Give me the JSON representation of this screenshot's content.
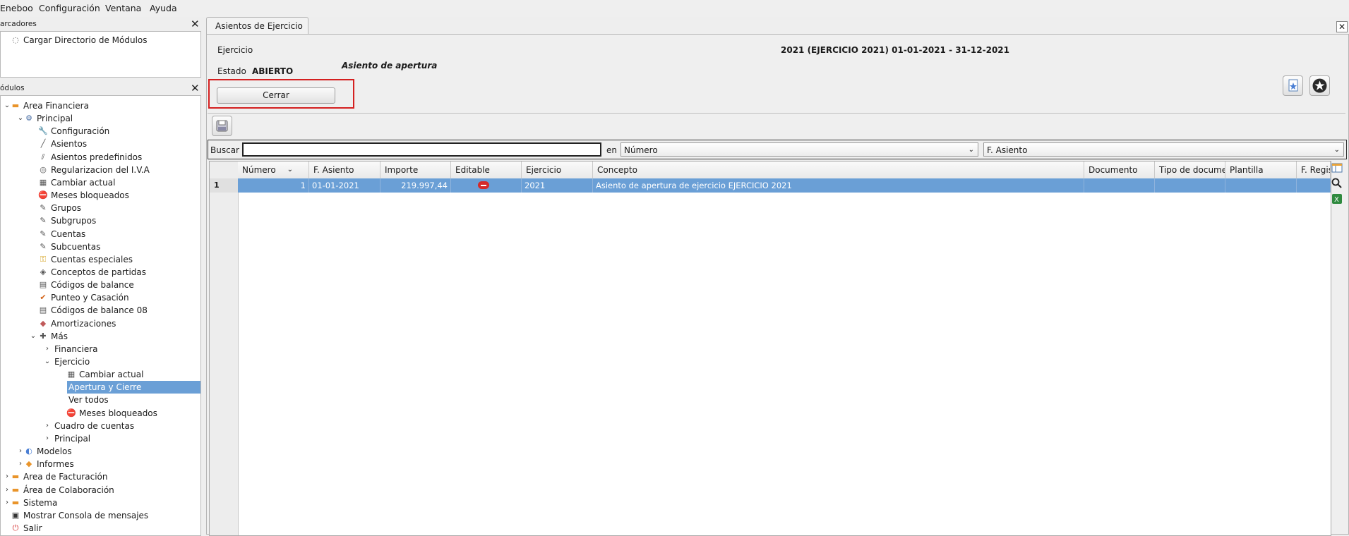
{
  "menubar": {
    "items": [
      "Eneboo",
      "Configuración",
      "Ventana",
      "Ayuda"
    ]
  },
  "bookmarks": {
    "title": "arcadores",
    "items": [
      {
        "label": "Cargar Directorio de Módulos",
        "icon": "loading-icon"
      }
    ]
  },
  "modules": {
    "title": "ódulos",
    "tree": [
      {
        "label": "Area Financiera",
        "icon": "folder-icon",
        "level": 0,
        "expanded": true
      },
      {
        "label": "Principal",
        "icon": "gear-icon",
        "level": 1,
        "expanded": true
      },
      {
        "label": "Configuración",
        "icon": "wrench-icon",
        "level": 2
      },
      {
        "label": "Asientos",
        "icon": "pen-icon",
        "level": 2
      },
      {
        "label": "Asientos predefinidos",
        "icon": "double-pen-icon",
        "level": 2
      },
      {
        "label": "Regularizacion del I.V.A",
        "icon": "iva-icon",
        "level": 2
      },
      {
        "label": "Cambiar actual",
        "icon": "calendar-icon",
        "level": 2
      },
      {
        "label": "Meses bloqueados",
        "icon": "stop-icon",
        "level": 2
      },
      {
        "label": "Grupos",
        "icon": "pencil-icon",
        "level": 2
      },
      {
        "label": "Subgrupos",
        "icon": "pencil-icon",
        "level": 2
      },
      {
        "label": "Cuentas",
        "icon": "pencil-icon",
        "level": 2
      },
      {
        "label": "Subcuentas",
        "icon": "pencil-icon",
        "level": 2
      },
      {
        "label": "Cuentas especiales",
        "icon": "key-icon",
        "level": 2
      },
      {
        "label": "Conceptos de partidas",
        "icon": "compass-icon",
        "level": 2
      },
      {
        "label": "Códigos de balance",
        "icon": "document-icon",
        "level": 2
      },
      {
        "label": "Punteo y Casación",
        "icon": "check-icon",
        "level": 2
      },
      {
        "label": "Códigos de balance 08",
        "icon": "document-08-icon",
        "level": 2
      },
      {
        "label": "Amortizaciones",
        "icon": "amortization-icon",
        "level": 2
      },
      {
        "label": "Más",
        "icon": "plus-icon",
        "level": 2,
        "expanded": true
      },
      {
        "label": "Financiera",
        "icon": "",
        "level": 3,
        "collapsed": true
      },
      {
        "label": "Ejercicio",
        "icon": "",
        "level": 3,
        "expanded": true
      },
      {
        "label": "Cambiar actual",
        "icon": "calendar-icon",
        "level": 4
      },
      {
        "label": "Apertura y Cierre",
        "icon": "",
        "level": 4,
        "selected": true
      },
      {
        "label": "Ver todos",
        "icon": "",
        "level": 4
      },
      {
        "label": "Meses bloqueados",
        "icon": "stop-icon",
        "level": 4
      },
      {
        "label": "Cuadro de cuentas",
        "icon": "",
        "level": 3,
        "collapsed": true
      },
      {
        "label": "Principal",
        "icon": "",
        "level": 3,
        "collapsed": true
      },
      {
        "label": "Modelos",
        "icon": "models-icon",
        "level": 1,
        "collapsed": true
      },
      {
        "label": "Informes",
        "icon": "reports-icon",
        "level": 1,
        "collapsed": true
      },
      {
        "label": "Area de Facturación",
        "icon": "folder-icon",
        "level": 0,
        "collapsed": true
      },
      {
        "label": "Área de Colaboración",
        "icon": "folder-icon",
        "level": 0,
        "collapsed": true
      },
      {
        "label": "Sistema",
        "icon": "folder-icon",
        "level": 0,
        "collapsed": true
      },
      {
        "label": "Mostrar Consola de mensajes",
        "icon": "console-icon",
        "level": 0
      },
      {
        "label": "Salir",
        "icon": "power-icon",
        "level": 0
      }
    ]
  },
  "tab": {
    "label": "Asientos de Ejercicio"
  },
  "form": {
    "ejercicio_label": "Ejercicio",
    "ejercicio_value": "2021 (EJERCICIO 2021) 01-01-2021 - 31-12-2021",
    "estado_label": "Estado",
    "estado_value": "ABIERTO",
    "asiento_apertura": "Asiento de apertura",
    "cerrar_button": "Cerrar"
  },
  "search": {
    "label": "Buscar",
    "value": "",
    "in_label": "en",
    "field_select": "Número",
    "order_select": "F. Asiento"
  },
  "grid": {
    "columns": [
      "Número",
      "F. Asiento",
      "Importe",
      "Editable",
      "Ejercicio",
      "Concepto",
      "Documento",
      "Tipo de docume",
      "Plantilla",
      "F. Regis"
    ],
    "rows": [
      {
        "row_header": "1",
        "cells": [
          "1",
          "01-01-2021",
          "219.997,44",
          "",
          "2021",
          "Asiento de apertura de ejercicio EJERCICIO 2021",
          "",
          "",
          "",
          ""
        ]
      }
    ]
  },
  "colors": {
    "selection": "#6a9fd6",
    "highlight_border": "#d42020",
    "background": "#eeeeee"
  }
}
